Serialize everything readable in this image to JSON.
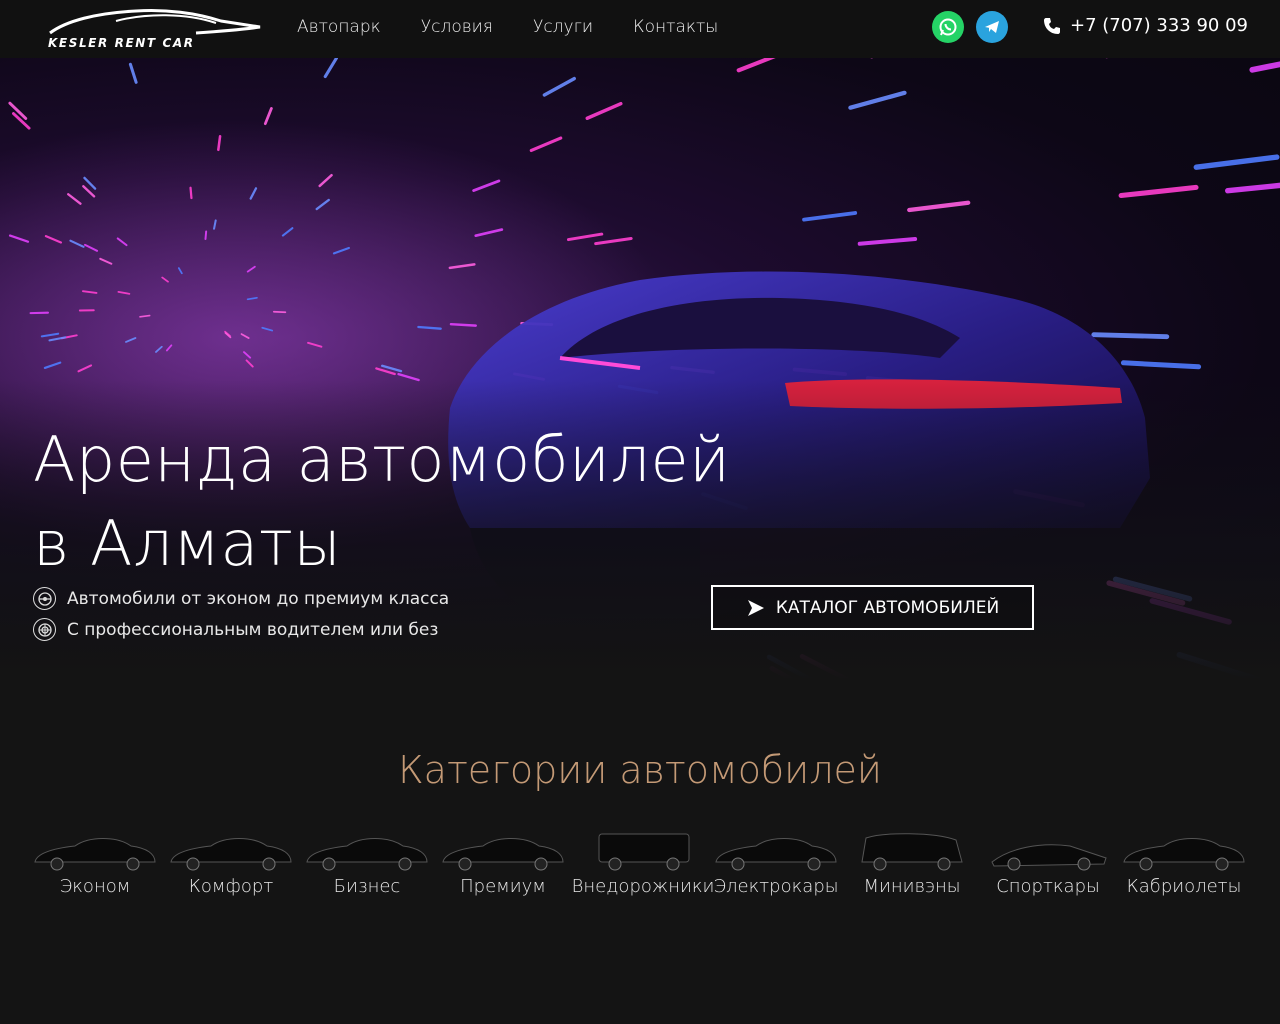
{
  "header": {
    "logo_text": "KESLER RENT CAR",
    "nav": [
      "Автопарк",
      "Условия",
      "Услуги",
      "Контакты"
    ],
    "phone": "+7 (707) 333 90 09",
    "icons": {
      "whatsapp": "whatsapp-icon",
      "telegram": "telegram-icon",
      "phone": "phone-icon"
    }
  },
  "hero": {
    "title_line1": "Аренда автомобилей",
    "title_line2": "в Алматы",
    "features": [
      "Автомобили от эконом до премиум класса",
      "С профессиональным водителем или без"
    ],
    "cta_label": "КАТАЛОГ АВТОМОБИЛЕЙ"
  },
  "categories": {
    "title": "Категории автомобилей",
    "items": [
      "Эконом",
      "Комфорт",
      "Бизнес",
      "Премиум",
      "Внедорожники",
      "Электрокары",
      "Минивэны",
      "Спорткары",
      "Кабриолеты"
    ]
  },
  "colors": {
    "accent": "#c49a76",
    "header_bg": "#111111",
    "page_bg": "#141414",
    "whatsapp": "#25d366",
    "telegram": "#2aa3de"
  }
}
